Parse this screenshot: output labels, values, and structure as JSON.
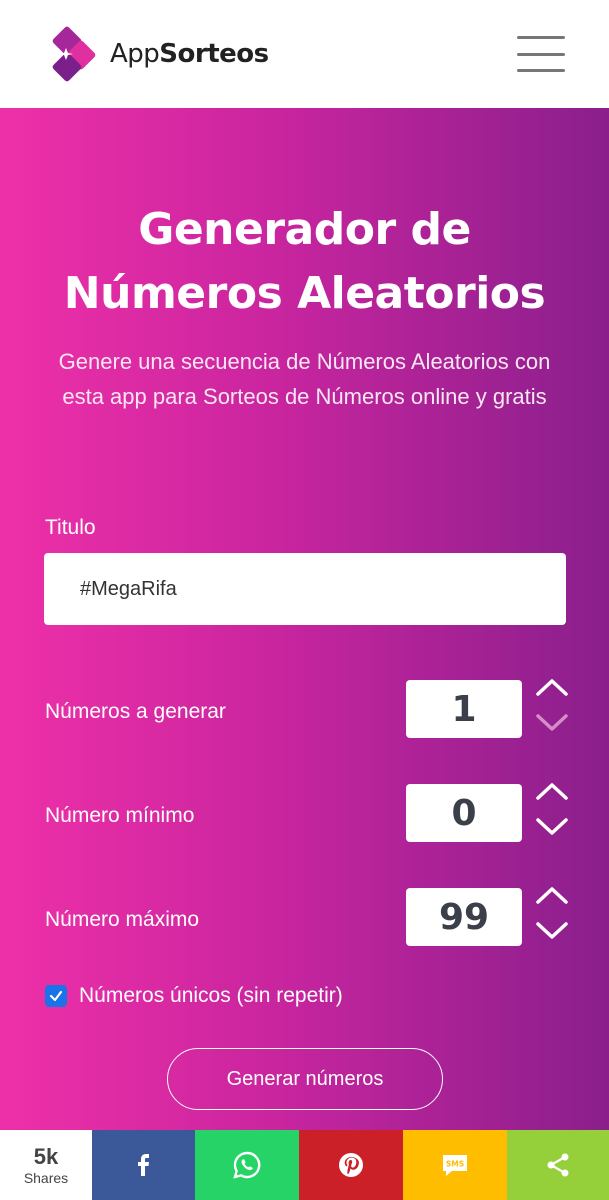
{
  "header": {
    "logo_text_light": "App",
    "logo_text_bold": "Sorteos",
    "menu_icon": "hamburger-menu-icon"
  },
  "hero": {
    "title_line1": "Generador de",
    "title_line2": "Números Aleatorios",
    "subtitle": "Genere una secuencia de Números Aleatorios con esta app para Sorteos de Números online y gratis"
  },
  "form": {
    "title_label": "Titulo",
    "title_value": "#MegaRifa",
    "rows": [
      {
        "label": "Números a generar",
        "value": "1"
      },
      {
        "label": "Número mínimo",
        "value": "0"
      },
      {
        "label": "Número máximo",
        "value": "99"
      }
    ],
    "unique_label": "Números únicos (sin repetir)",
    "unique_checked": true,
    "generate_button": "Generar números"
  },
  "share_bar": {
    "count": "5k",
    "count_label": "Shares",
    "buttons": [
      {
        "name": "facebook",
        "icon": "facebook-icon",
        "color": "#3b5998"
      },
      {
        "name": "whatsapp",
        "icon": "whatsapp-icon",
        "color": "#25d366"
      },
      {
        "name": "pinterest",
        "icon": "pinterest-icon",
        "color": "#cb2027"
      },
      {
        "name": "sms",
        "icon": "sms-icon",
        "color": "#ffbd00"
      },
      {
        "name": "share",
        "icon": "share-icon",
        "color": "#95d03a"
      }
    ]
  },
  "colors": {
    "gradient_start": "#ee30a8",
    "gradient_end": "#8a1f8c",
    "checkbox": "#1a73e8"
  }
}
